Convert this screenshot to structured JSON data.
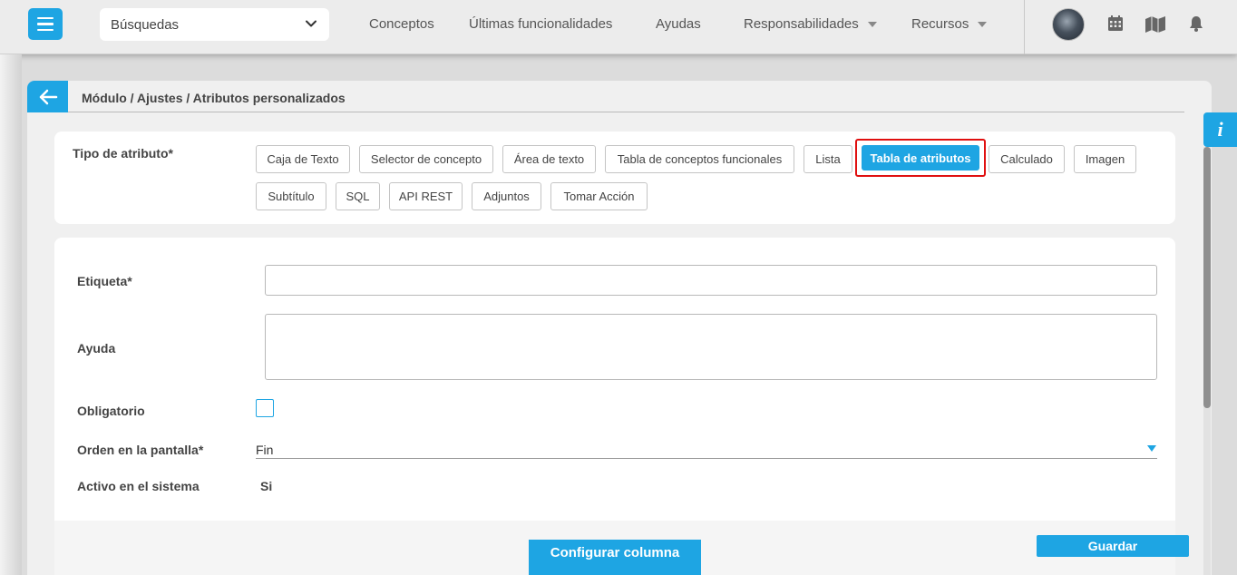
{
  "header": {
    "search_select": "Búsquedas",
    "nav": [
      {
        "label": "Conceptos"
      },
      {
        "label": "Últimas funcionalidades"
      },
      {
        "label": "Ayudas"
      },
      {
        "label": "Responsabilidades"
      },
      {
        "label": "Recursos"
      }
    ],
    "icons": [
      "calendar-icon",
      "map-icon",
      "bell-icon"
    ]
  },
  "breadcrumb": "Módulo / Ajustes / Atributos personalizados",
  "info_tab": "i",
  "attribute_type": {
    "label": "Tipo de atributo*",
    "options": [
      "Caja de Texto",
      "Selector de concepto",
      "Área de texto",
      "Tabla de conceptos funcionales",
      "Lista",
      "Tabla de atributos",
      "Calculado",
      "Imagen",
      "Subtítulo",
      "SQL",
      "API REST",
      "Adjuntos",
      "Tomar Acción"
    ],
    "selected": "Tabla de atributos"
  },
  "form": {
    "label_field": {
      "label": "Etiqueta*",
      "value": ""
    },
    "help_field": {
      "label": "Ayuda",
      "value": ""
    },
    "required_field": {
      "label": "Obligatorio",
      "checked": false
    },
    "order_field": {
      "label": "Orden en la pantalla*",
      "value": "Fin"
    },
    "active_field": {
      "label": "Activo en el sistema",
      "value": "Si"
    }
  },
  "buttons": {
    "configure": "Configurar columna",
    "save": "Guardar"
  },
  "colors": {
    "accent": "#1ea5e3",
    "highlight": "#e01010"
  }
}
